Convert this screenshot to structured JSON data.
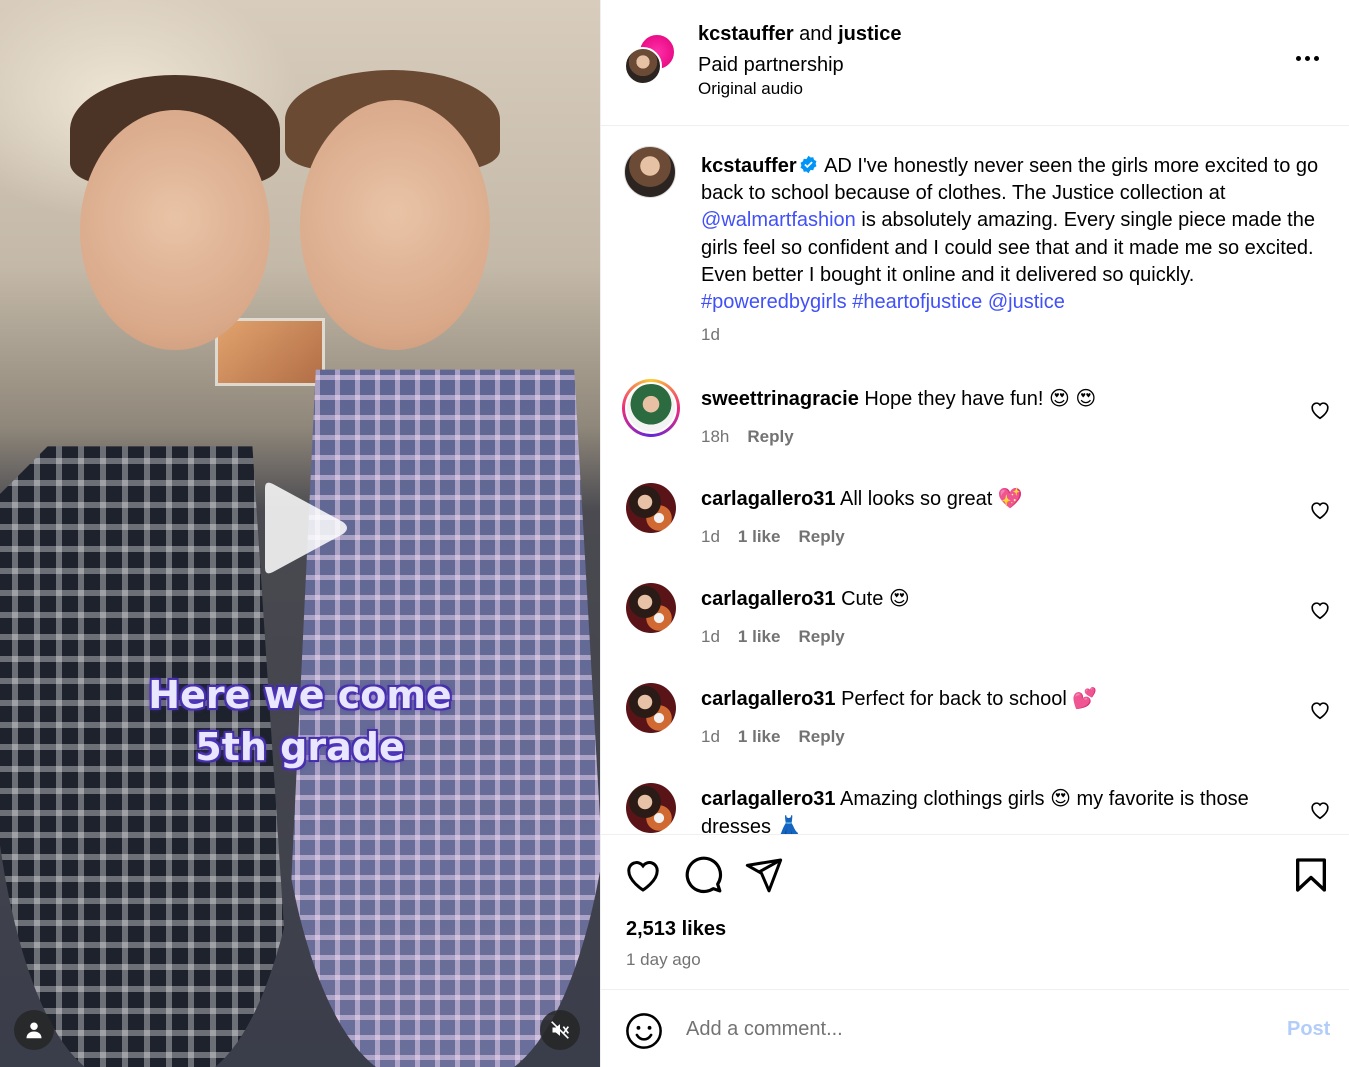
{
  "media": {
    "overlay_line1": "Here we come",
    "overlay_line2": "5th grade"
  },
  "header": {
    "author": "kcstauffer",
    "joiner": "and",
    "partner": "justice",
    "paid_label": "Paid partnership",
    "audio_label": "Original audio"
  },
  "caption": {
    "username": "kcstauffer",
    "text_part1": " AD I've honestly never seen the girls more excited to go back to school because of clothes. The Justice collection at ",
    "mention_walmart": "@walmartfashion",
    "text_part2": " is absolutely amazing. Every single piece made the girls feel so confident and I could see that and it made me so excited. Even better I bought it online and it delivered so quickly. ",
    "hashtag1": "#poweredbygirls",
    "hashtag2": "#heartofjustice",
    "mention_justice": "@justice",
    "time": "1d"
  },
  "comments": [
    {
      "username": "sweettrinagracie",
      "text": "Hope they have fun!",
      "emoji": "😍 😍",
      "time": "18h",
      "likes": "",
      "reply": "Reply"
    },
    {
      "username": "carlagallero31",
      "text": "All looks so great",
      "emoji": "💖",
      "time": "1d",
      "likes": "1 like",
      "reply": "Reply"
    },
    {
      "username": "carlagallero31",
      "text": "Cute",
      "emoji": "😍",
      "time": "1d",
      "likes": "1 like",
      "reply": "Reply"
    },
    {
      "username": "carlagallero31",
      "text": "Perfect for back to school",
      "emoji": "💕",
      "time": "1d",
      "likes": "1 like",
      "reply": "Reply"
    },
    {
      "username": "carlagallero31",
      "text": "Amazing clothings girls",
      "emoji": "😍",
      "text2": " my favorite is those dresses",
      "emoji2": "👗"
    }
  ],
  "stats": {
    "likes": "2,513 likes",
    "posted": "1 day ago"
  },
  "composer": {
    "placeholder": "Add a comment...",
    "post_label": "Post"
  },
  "colors": {
    "link": "#4150f7",
    "muted": "#737373",
    "post_disabled": "#b3cdfa",
    "verified": "#0095f6"
  },
  "icons": [
    "play-icon",
    "user-tag-icon",
    "mute-icon",
    "more-icon",
    "verified-icon",
    "heart-icon",
    "comment-icon",
    "share-icon",
    "bookmark-icon",
    "emoji-icon"
  ]
}
